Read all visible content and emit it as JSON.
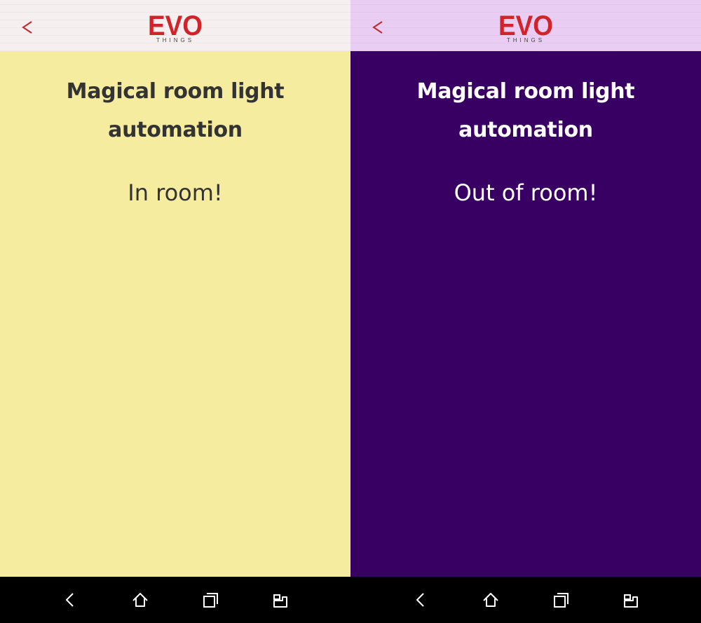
{
  "colors": {
    "accent_red": "#d1232a",
    "left_background": "#f5ec9f",
    "right_background": "#380062",
    "left_header": "#f6efef",
    "right_header": "#e9cdf3",
    "dark_text": "#333333",
    "light_text": "#ffffff",
    "nav_bar": "#000000"
  },
  "screens": [
    {
      "header": {
        "back_icon": "chevron-left-icon",
        "logo": {
          "word": "EVO",
          "subtitle": "THINGS"
        }
      },
      "title": "Magical room light automation",
      "status": "In room!",
      "nav": {
        "back_icon": "back-arrow-icon",
        "home_icon": "home-icon",
        "recents_icon": "recent-apps-icon",
        "extra_icon": "multiwindow-icon"
      }
    },
    {
      "header": {
        "back_icon": "chevron-left-icon",
        "logo": {
          "word": "EVO",
          "subtitle": "THINGS"
        }
      },
      "title": "Magical room light automation",
      "status": "Out of room!",
      "nav": {
        "back_icon": "back-arrow-icon",
        "home_icon": "home-icon",
        "recents_icon": "recent-apps-icon",
        "extra_icon": "multiwindow-icon"
      }
    }
  ]
}
